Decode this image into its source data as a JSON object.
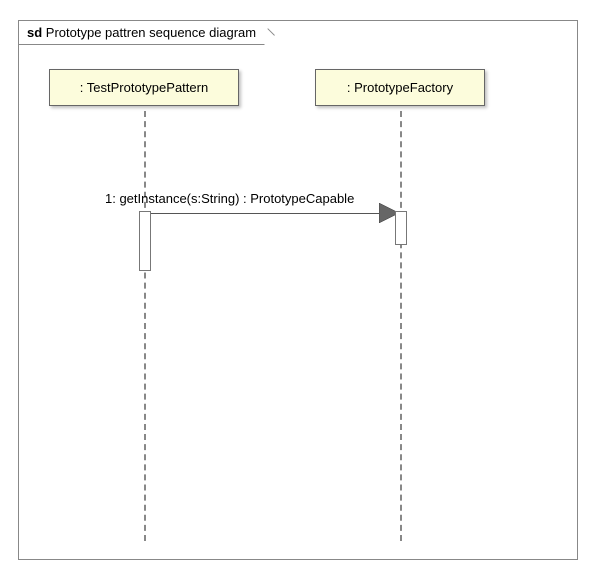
{
  "frame": {
    "prefix": "sd",
    "title": "Prototype pattren sequence diagram"
  },
  "lifelines": {
    "left": {
      "label": ": TestPrototypePattern"
    },
    "right": {
      "label": ": PrototypeFactory"
    }
  },
  "message": {
    "label": "1: getInstance(s:String) : PrototypeCapable"
  },
  "chart_data": {
    "type": "sequence-diagram",
    "frame_label": "sd Prototype pattren sequence diagram",
    "lifelines": [
      {
        "name": "TestPrototypePattern"
      },
      {
        "name": "PrototypeFactory"
      }
    ],
    "messages": [
      {
        "seq": 1,
        "from": "TestPrototypePattern",
        "to": "PrototypeFactory",
        "signature": "getInstance(s:String) : PrototypeCapable",
        "type": "synchronous"
      }
    ]
  }
}
